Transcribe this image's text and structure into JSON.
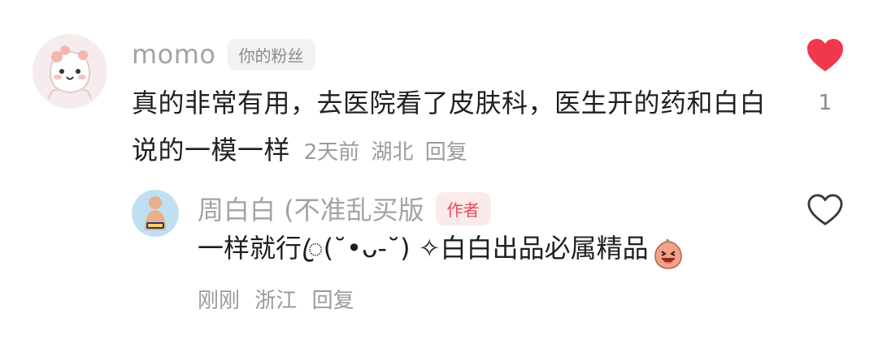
{
  "comment": {
    "username": "momo",
    "badge": "你的粉丝",
    "text": "真的非常有用，去医院看了皮肤科，医生开的药和白白说的一模一样",
    "time": "2天前",
    "location": "湖北",
    "reply_label": "回复",
    "like_count": "1",
    "liked": true,
    "like_color": "#f0374b"
  },
  "reply": {
    "username": "周白白 (不准乱买版",
    "badge": "作者",
    "text": "一样就行ꦿ(˘•ᴗ-˘) ✧白白出品必属精品",
    "emoji": "laughing-peach-emoji",
    "time": "刚刚",
    "location": "浙江",
    "reply_label": "回复",
    "liked": false
  }
}
